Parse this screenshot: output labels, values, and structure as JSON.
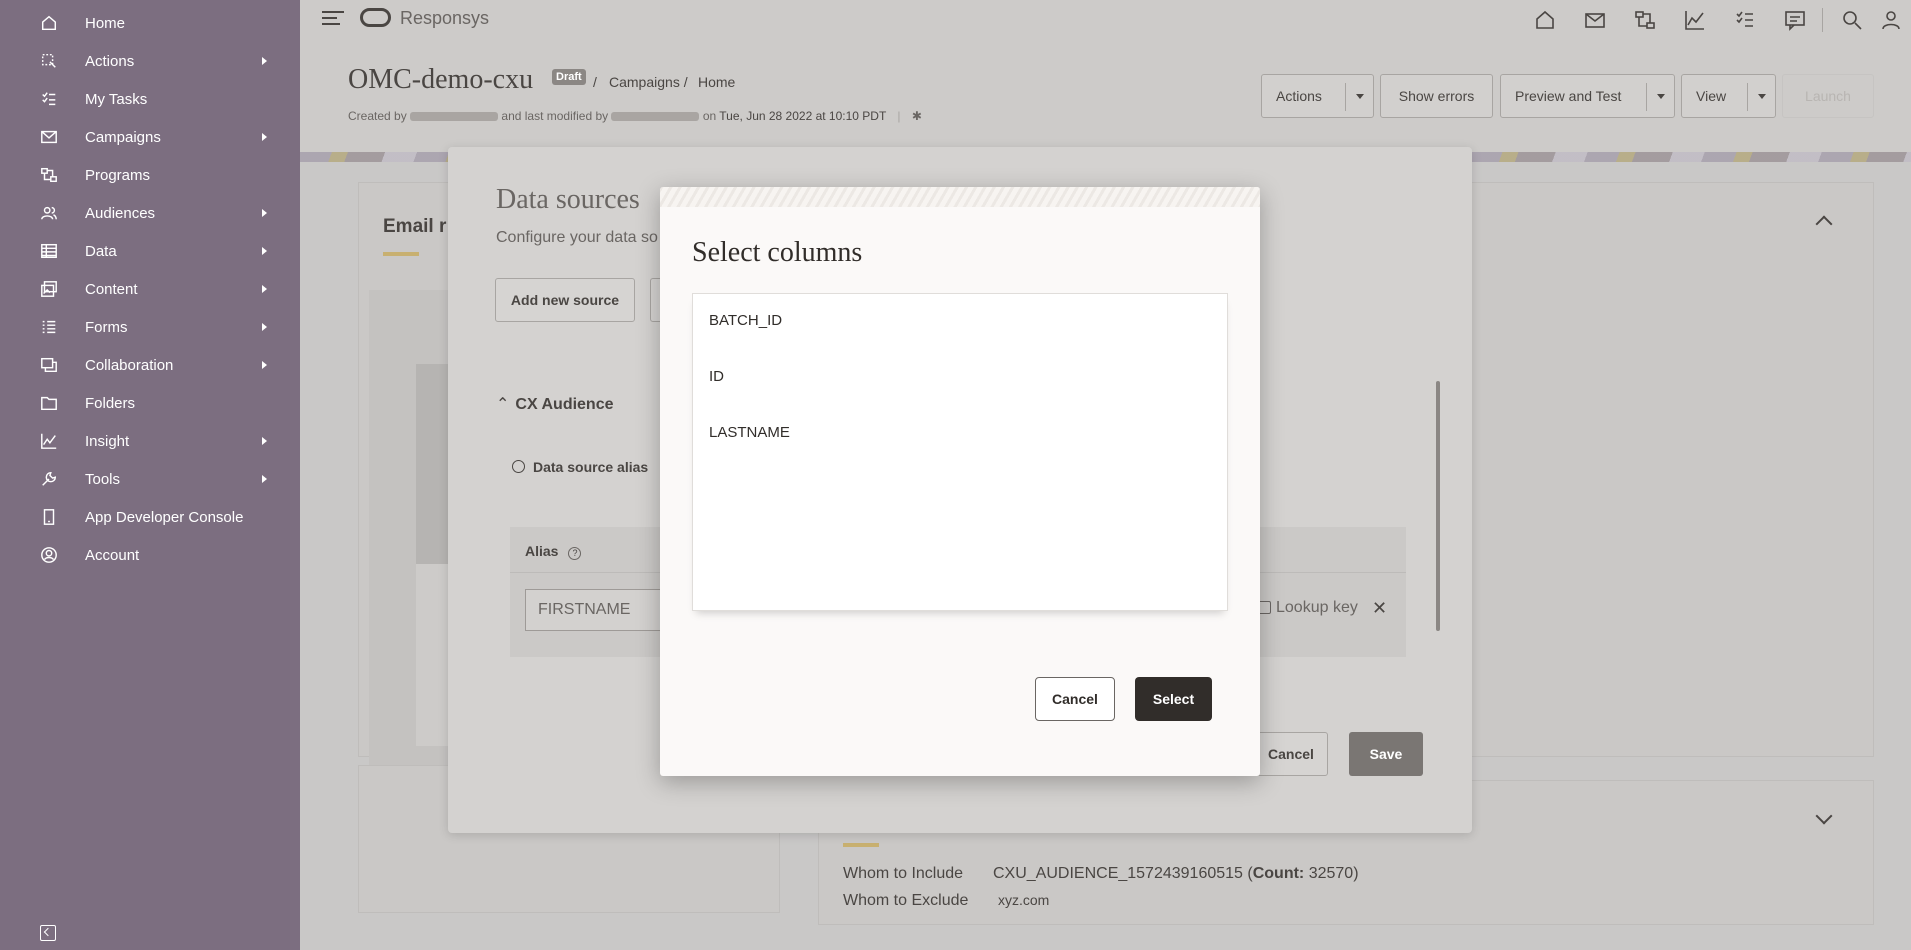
{
  "sidebar": {
    "items": [
      {
        "label": "Home",
        "icon": "home-icon",
        "submenu": false
      },
      {
        "label": "Actions",
        "icon": "actions-icon",
        "submenu": true
      },
      {
        "label": "My Tasks",
        "icon": "tasks-icon",
        "submenu": false
      },
      {
        "label": "Campaigns",
        "icon": "mail-icon",
        "submenu": true
      },
      {
        "label": "Programs",
        "icon": "programs-icon",
        "submenu": false
      },
      {
        "label": "Audiences",
        "icon": "audiences-icon",
        "submenu": true
      },
      {
        "label": "Data",
        "icon": "data-icon",
        "submenu": true
      },
      {
        "label": "Content",
        "icon": "content-icon",
        "submenu": true
      },
      {
        "label": "Forms",
        "icon": "forms-icon",
        "submenu": true
      },
      {
        "label": "Collaboration",
        "icon": "collaboration-icon",
        "submenu": true
      },
      {
        "label": "Folders",
        "icon": "folder-icon",
        "submenu": false
      },
      {
        "label": "Insight",
        "icon": "insight-icon",
        "submenu": true
      },
      {
        "label": "Tools",
        "icon": "wrench-icon",
        "submenu": true
      },
      {
        "label": "App Developer Console",
        "icon": "device-icon",
        "submenu": false
      },
      {
        "label": "Account",
        "icon": "account-icon",
        "submenu": false
      }
    ]
  },
  "topbar": {
    "brand": "Responsys",
    "icons": [
      "home-icon",
      "mail-icon",
      "programs-icon",
      "insight-icon",
      "tasks-icon",
      "collaboration-icon",
      "search-icon",
      "user-icon"
    ]
  },
  "header": {
    "title": "OMC-demo-cxu",
    "badge": "Draft",
    "sep1": "/",
    "crumb1": "Campaigns /",
    "crumb2": "Home",
    "meta_created": "Created by",
    "meta_modified": "and last modified by",
    "meta_on": "on",
    "meta_date": "Tue, Jun 28 2022 at 10:10 PDT",
    "buttons": {
      "actions": "Actions",
      "show_errors": "Show errors",
      "preview": "Preview and Test",
      "view": "View",
      "launch": "Launch"
    }
  },
  "background": {
    "email_card_title": "Email r",
    "whom_include_label": "Whom to Include",
    "whom_include_value": "CXU_AUDIENCE_1572439160515 (",
    "count_label": "Count:",
    "count_value": " 32570)",
    "whom_exclude_label": "Whom to Exclude",
    "whom_exclude_value": "xyz.com"
  },
  "data_sources": {
    "title": "Data sources",
    "subtitle": "Configure your data so",
    "add_source": "Add new source",
    "section": "CX Audience",
    "alias_row": "Data source alias",
    "alias_header": "Alias",
    "alias_value": "FIRSTNAME",
    "lookup_key": "Lookup key",
    "cancel": "Cancel",
    "save": "Save"
  },
  "modal": {
    "title": "Select columns",
    "columns": [
      "BATCH_ID",
      "ID",
      "LASTNAME"
    ],
    "cancel": "Cancel",
    "select": "Select"
  }
}
